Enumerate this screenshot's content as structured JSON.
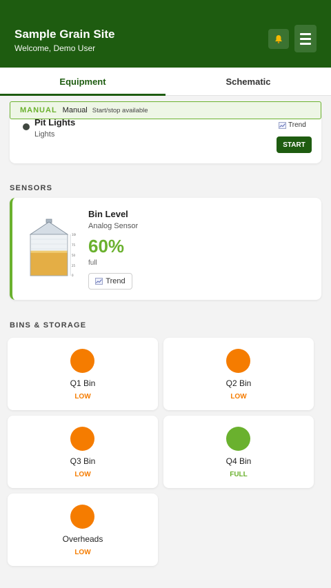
{
  "header": {
    "site_title": "Sample Grain Site",
    "welcome": "Welcome, Demo User"
  },
  "tabs": [
    {
      "label": "Equipment",
      "active": true
    },
    {
      "label": "Schematic",
      "active": false
    }
  ],
  "manual_bar": {
    "tag": "MANUAL",
    "label": "Manual",
    "description": "Start/stop available"
  },
  "equipment": {
    "name": "Pit Lights",
    "type": "Lights",
    "trend_label": "Trend",
    "start_label": "START"
  },
  "sections": {
    "sensors": "SENSORS",
    "bins": "BINS & STORAGE"
  },
  "sensor": {
    "name": "Bin Level",
    "type": "Analog Sensor",
    "value": "60%",
    "unit": "full",
    "trend_label": "Trend",
    "level_fraction": 0.6,
    "scale_labels": [
      "100",
      "75",
      "50",
      "25",
      "0"
    ]
  },
  "bins": [
    {
      "name": "Q1 Bin",
      "status": "LOW",
      "color": "#f57c00"
    },
    {
      "name": "Q2 Bin",
      "status": "LOW",
      "color": "#f57c00"
    },
    {
      "name": "Q3 Bin",
      "status": "LOW",
      "color": "#f57c00"
    },
    {
      "name": "Q4 Bin",
      "status": "FULL",
      "color": "#6ab12e"
    },
    {
      "name": "Overheads",
      "status": "LOW",
      "color": "#f57c00"
    }
  ],
  "colors": {
    "header_bg": "#1e5c10",
    "accent_green": "#6ab12e",
    "low_orange": "#f57c00"
  },
  "icons": {
    "bell": "bell-icon",
    "menu": "hamburger-menu-icon",
    "trend": "trend-chart-icon"
  }
}
